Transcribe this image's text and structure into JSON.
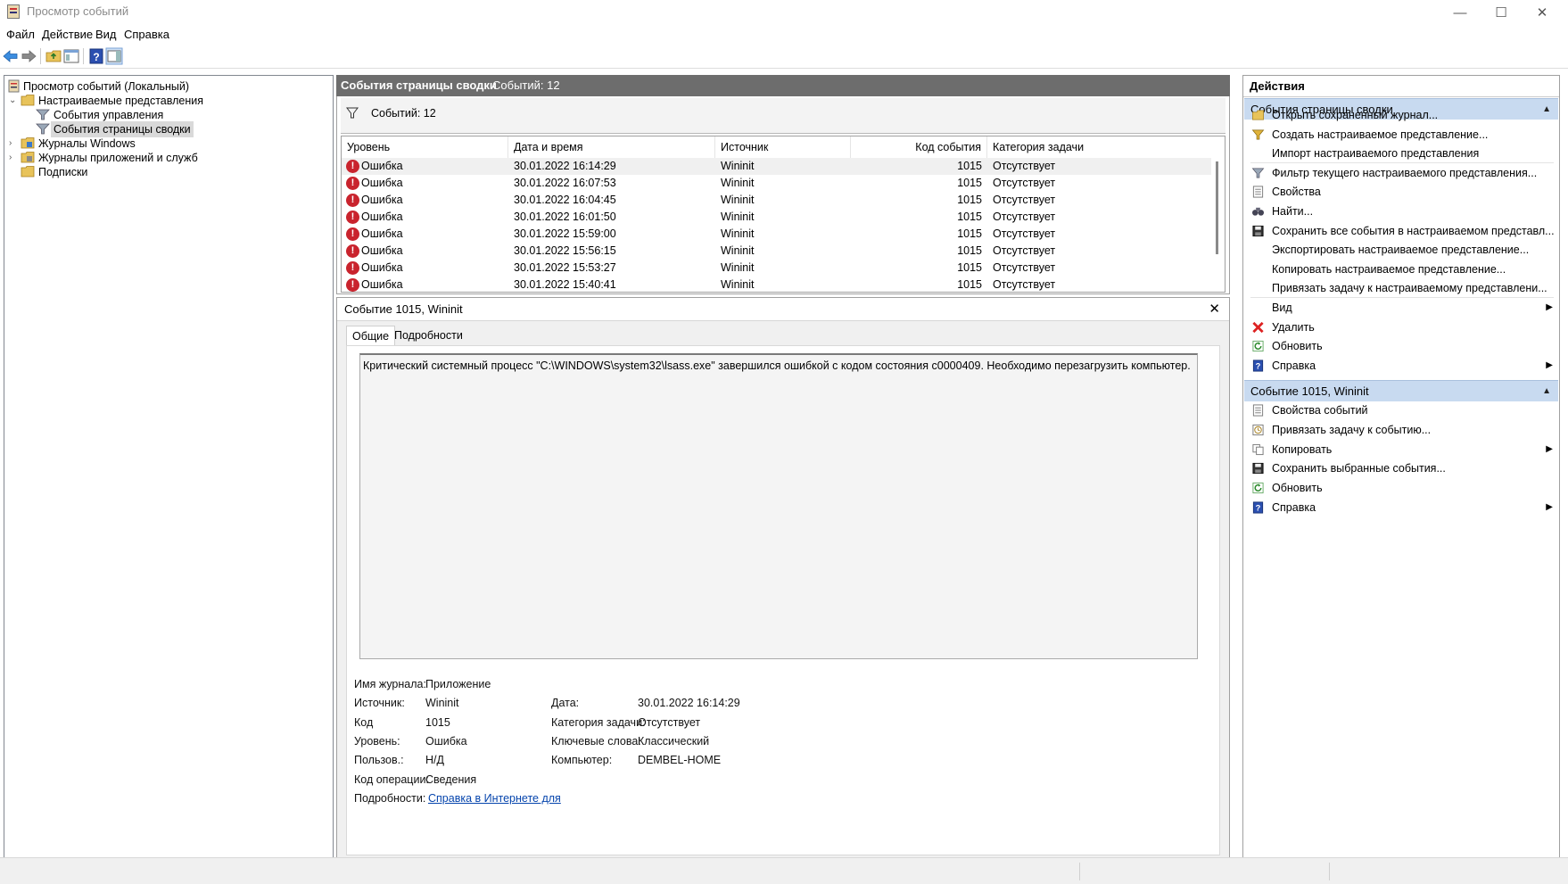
{
  "window": {
    "title": "Просмотр событий",
    "min_glyph": "—",
    "max_glyph": "☐",
    "close_glyph": "✕"
  },
  "menu": [
    "Файл",
    "Действие",
    "Вид",
    "Справка"
  ],
  "toolbar_icons": [
    "back-icon",
    "forward-icon",
    "up-folder-icon",
    "show-hide-tree-icon",
    "help-icon",
    "show-hide-action-pane-icon"
  ],
  "tree": {
    "root": "Просмотр событий (Локальный)",
    "custom_views": "Настраиваемые представления",
    "admin_events": "События управления",
    "summary_events": "События страницы сводки",
    "windows_logs": "Журналы Windows",
    "app_service_logs": "Журналы приложений и служб",
    "subscriptions": "Подписки"
  },
  "center": {
    "header_title": "События страницы сводки",
    "header_count": "Событий: 12",
    "filter_text": "Событий: 12"
  },
  "table": {
    "columns": [
      "Уровень",
      "Дата и время",
      "Источник",
      "Код события",
      "Категория задачи"
    ],
    "rows": [
      {
        "level": "Ошибка",
        "datetime": "30.01.2022 16:14:29",
        "source": "Wininit",
        "code": "1015",
        "category": "Отсутствует"
      },
      {
        "level": "Ошибка",
        "datetime": "30.01.2022 16:07:53",
        "source": "Wininit",
        "code": "1015",
        "category": "Отсутствует"
      },
      {
        "level": "Ошибка",
        "datetime": "30.01.2022 16:04:45",
        "source": "Wininit",
        "code": "1015",
        "category": "Отсутствует"
      },
      {
        "level": "Ошибка",
        "datetime": "30.01.2022 16:01:50",
        "source": "Wininit",
        "code": "1015",
        "category": "Отсутствует"
      },
      {
        "level": "Ошибка",
        "datetime": "30.01.2022 15:59:00",
        "source": "Wininit",
        "code": "1015",
        "category": "Отсутствует"
      },
      {
        "level": "Ошибка",
        "datetime": "30.01.2022 15:56:15",
        "source": "Wininit",
        "code": "1015",
        "category": "Отсутствует"
      },
      {
        "level": "Ошибка",
        "datetime": "30.01.2022 15:53:27",
        "source": "Wininit",
        "code": "1015",
        "category": "Отсутствует"
      },
      {
        "level": "Ошибка",
        "datetime": "30.01.2022 15:40:41",
        "source": "Wininit",
        "code": "1015",
        "category": "Отсутствует"
      }
    ]
  },
  "detail": {
    "title": "Событие 1015, Wininit",
    "close_glyph": "✕",
    "tabs": [
      "Общие",
      "Подробности"
    ],
    "message": "Критический системный процесс \"C:\\WINDOWS\\system32\\lsass.exe\" завершился ошибкой с кодом состояния c0000409.  Необходимо перезагрузить компьютер.",
    "fields": {
      "log_name_label": "Имя журнала:",
      "log_name": "Приложение",
      "source_label": "Источник:",
      "source": "Wininit",
      "date_label": "Дата:",
      "date": "30.01.2022 16:14:29",
      "code_label": "Код",
      "code": "1015",
      "task_label": "Категория задачи:",
      "task": "Отсутствует",
      "level_label": "Уровень:",
      "level": "Ошибка",
      "keywords_label": "Ключевые слова:",
      "keywords": "Классический",
      "user_label": "Пользов.:",
      "user": "Н/Д",
      "computer_label": "Компьютер:",
      "computer": "DEMBEL-HOME",
      "opcode_label": "Код операции:",
      "opcode": "Сведения",
      "more_label": "Подробности:",
      "more_link": "Справка в Интернете для "
    }
  },
  "actions": {
    "title": "Действия",
    "section1": "События страницы сводки",
    "items1": [
      {
        "label": "Открыть сохраненный журнал...",
        "icon": "open-log-icon",
        "submenu": false
      },
      {
        "label": "Создать настраиваемое представление...",
        "icon": "create-filter-icon",
        "submenu": false
      },
      {
        "label": "Импорт настраиваемого представления",
        "icon": "",
        "submenu": false
      },
      {
        "label": "Фильтр текущего настраиваемого представления...",
        "icon": "filter-icon",
        "submenu": false
      },
      {
        "label": "Свойства",
        "icon": "properties-icon",
        "submenu": false
      },
      {
        "label": "Найти...",
        "icon": "binoculars-icon",
        "submenu": false
      },
      {
        "label": "Сохранить все события в настраиваемом представл...",
        "icon": "save-icon",
        "submenu": false
      },
      {
        "label": "Экспортировать настраиваемое представление...",
        "icon": "",
        "submenu": false
      },
      {
        "label": "Копировать настраиваемое представление...",
        "icon": "",
        "submenu": false
      },
      {
        "label": "Привязать задачу к настраиваемому представлени...",
        "icon": "",
        "submenu": false
      },
      {
        "label": "Вид",
        "icon": "",
        "submenu": true
      },
      {
        "label": "Удалить",
        "icon": "delete-icon",
        "submenu": false
      },
      {
        "label": "Обновить",
        "icon": "refresh-icon",
        "submenu": false
      },
      {
        "label": "Справка",
        "icon": "help-icon",
        "submenu": true
      }
    ],
    "section2": "Событие 1015, Wininit",
    "items2": [
      {
        "label": "Свойства событий",
        "icon": "event-properties-icon",
        "submenu": false
      },
      {
        "label": "Привязать задачу к событию...",
        "icon": "attach-task-icon",
        "submenu": false
      },
      {
        "label": "Копировать",
        "icon": "copy-icon",
        "submenu": true
      },
      {
        "label": "Сохранить выбранные события...",
        "icon": "save-icon",
        "submenu": false
      },
      {
        "label": "Обновить",
        "icon": "refresh-icon",
        "submenu": false
      },
      {
        "label": "Справка",
        "icon": "help-icon",
        "submenu": true
      }
    ]
  },
  "colors": {
    "header_bg": "#6d6d6d",
    "section_bg": "#c8daf0",
    "error_red": "#c9232d",
    "link_blue": "#0645ad"
  }
}
